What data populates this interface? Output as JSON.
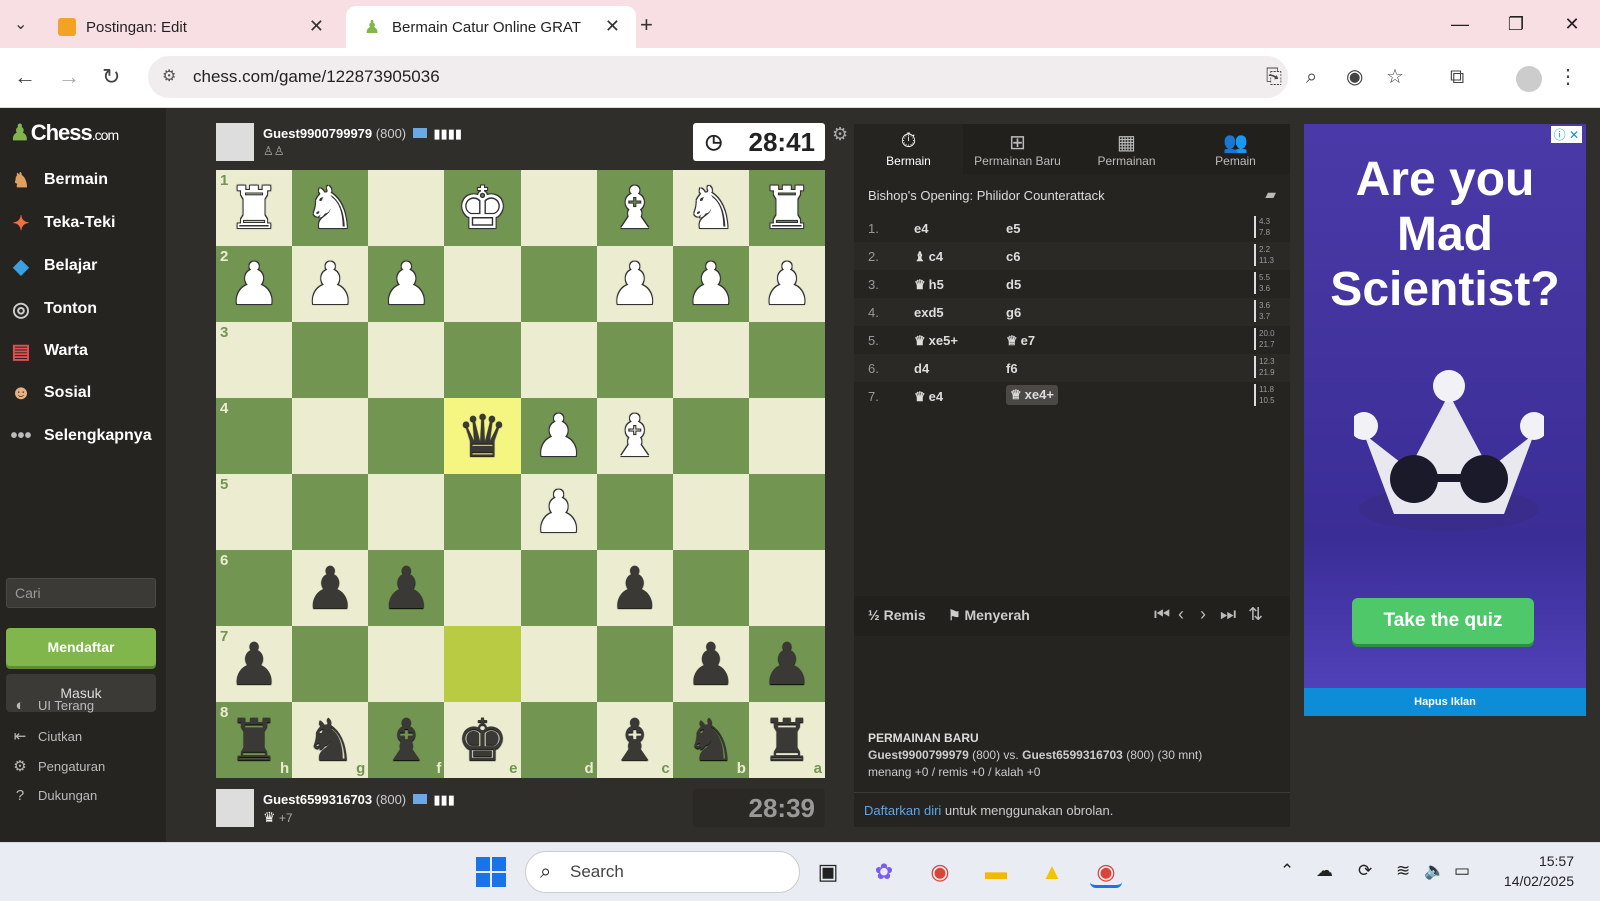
{
  "browser": {
    "tabs": [
      {
        "title": "Postingan: Edit",
        "favicon": "blogger-icon",
        "color": "#f4a223"
      },
      {
        "title": "Bermain Catur Online GRATIS - ",
        "favicon": "chess-pawn-icon",
        "color": "#81b64c"
      }
    ],
    "url": "chess.com/game/122873905036"
  },
  "sidebar": {
    "logo": "Chess",
    "logo_suffix": ".com",
    "items": [
      {
        "label": "Bermain",
        "icon": "play-icon"
      },
      {
        "label": "Teka-Teki",
        "icon": "puzzle-icon"
      },
      {
        "label": "Belajar",
        "icon": "learn-icon"
      },
      {
        "label": "Tonton",
        "icon": "watch-icon"
      },
      {
        "label": "Warta",
        "icon": "news-icon"
      },
      {
        "label": "Sosial",
        "icon": "social-icon"
      },
      {
        "label": "Selengkapnya",
        "icon": "more-icon"
      }
    ],
    "search_placeholder": "Cari",
    "signup_label": "Mendaftar",
    "login_label": "Masuk",
    "bottom": [
      {
        "label": "UI Terang",
        "icon": "contrast-icon"
      },
      {
        "label": "Ciutkan",
        "icon": "collapse-icon"
      },
      {
        "label": "Pengaturan",
        "icon": "settings-icon"
      },
      {
        "label": "Dukungan",
        "icon": "help-icon"
      }
    ]
  },
  "players": {
    "top": {
      "name": "Guest9900799979",
      "rating": "(800)",
      "clock": "28:41"
    },
    "bottom": {
      "name": "Guest6599316703",
      "rating": "(800)",
      "clock": "28:39",
      "material": "+7"
    }
  },
  "board": {
    "ranks": [
      "1",
      "2",
      "3",
      "4",
      "5",
      "6",
      "7",
      "8"
    ],
    "files": [
      "h",
      "g",
      "f",
      "e",
      "d",
      "c",
      "b",
      "a"
    ],
    "rows": [
      [
        "wR",
        "wN",
        "",
        "wK",
        "",
        "wB",
        "wN",
        "wR"
      ],
      [
        "wP",
        "wP",
        "wP",
        "",
        "",
        "wP",
        "wP",
        "wP"
      ],
      [
        "",
        "",
        "",
        "",
        "",
        "",
        "",
        ""
      ],
      [
        "",
        "",
        "",
        "bQ",
        "wP",
        "wB",
        "",
        ""
      ],
      [
        "",
        "",
        "",
        "",
        "wP",
        "",
        "",
        ""
      ],
      [
        "",
        "bP",
        "bP",
        "",
        "",
        "bP",
        "",
        ""
      ],
      [
        "bP",
        "",
        "",
        "",
        "",
        "",
        "bP",
        "bP"
      ],
      [
        "bR",
        "bN",
        "bB",
        "bK",
        "",
        "bB",
        "bN",
        "bR"
      ]
    ],
    "highlight": [
      [
        3,
        3
      ]
    ],
    "highlight_prev": [
      [
        6,
        3
      ]
    ],
    "colors": {
      "light": "#ebecd0",
      "dark": "#739552"
    }
  },
  "panel": {
    "tabs": [
      {
        "label": "Bermain",
        "icon": "stopwatch-icon",
        "active": true
      },
      {
        "label": "Permainan Baru",
        "icon": "plus-icon"
      },
      {
        "label": "Permainan",
        "icon": "board-icon"
      },
      {
        "label": "Pemain",
        "icon": "players-icon"
      }
    ],
    "opening": "Bishop's Opening: Philidor Counterattack",
    "moves": [
      {
        "num": "1.",
        "white": "e4",
        "black": "e5",
        "t1": "4.3",
        "t2": "7.8"
      },
      {
        "num": "2.",
        "white": "c4",
        "wp": "♝",
        "black": "c6",
        "t1": "2.2",
        "t2": "11.3"
      },
      {
        "num": "3.",
        "white": "h5",
        "wp": "♛",
        "black": "d5",
        "t1": "5.5",
        "t2": "3.6"
      },
      {
        "num": "4.",
        "white": "exd5",
        "black": "g6",
        "t1": "3.6",
        "t2": "3.7"
      },
      {
        "num": "5.",
        "white": "xe5+",
        "wp": "♛",
        "black": "e7",
        "bp": "♕",
        "t1": "20.0",
        "t2": "21.7"
      },
      {
        "num": "6.",
        "white": "d4",
        "black": "f6",
        "t1": "12.3",
        "t2": "21.9"
      },
      {
        "num": "7.",
        "white": "e4",
        "wp": "♛",
        "black": "xe4+",
        "bp": "♕",
        "t1": "11.8",
        "t2": "10.5"
      }
    ],
    "draw_label": "Remis",
    "draw_icon": "½",
    "resign_label": "Menyerah",
    "newgame_heading": "PERMAINAN BARU",
    "newgame_p1": "Guest9900799979",
    "newgame_vs": " (800) vs. ",
    "newgame_p2": "Guest6599316703",
    "newgame_tail": " (800) (30 mnt)",
    "newgame_record": "menang +0 / remis +0 / kalah +0",
    "chat_link": "Daftarkan diri",
    "chat_text": " untuk menggunakan obrolan."
  },
  "ad": {
    "title": "Are you Mad Scientist?",
    "button": "Take the quiz",
    "remove": "Hapus Iklan"
  },
  "taskbar": {
    "search": "Search",
    "time": "15:57",
    "date": "14/02/2025"
  }
}
